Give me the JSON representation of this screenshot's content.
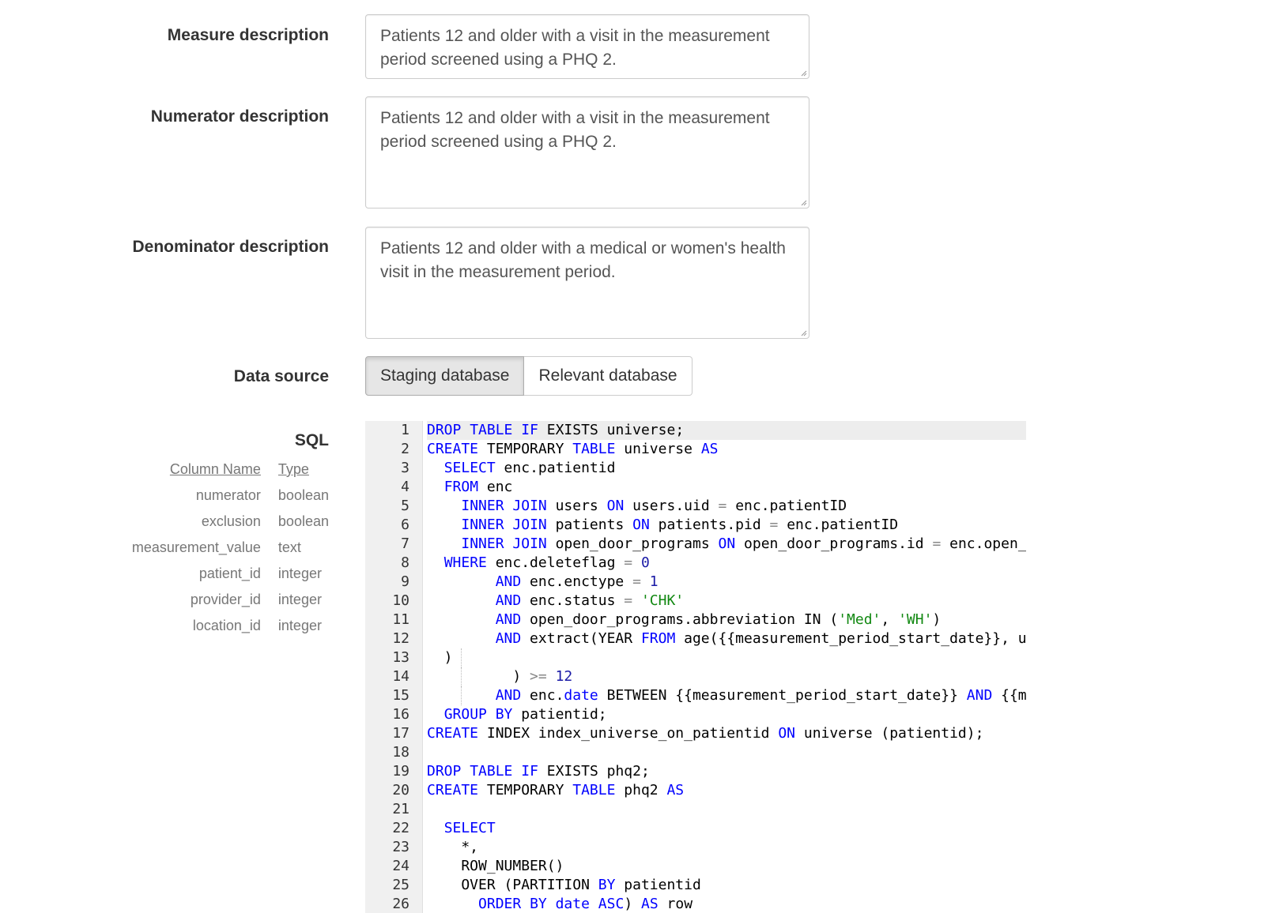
{
  "fields": {
    "measure_label": "Measure description",
    "measure_value": "Patients 12 and older with a visit in the measurement period screened using a PHQ 2.",
    "numerator_label": "Numerator description",
    "numerator_value": "Patients 12 and older with a visit in the measurement period screened using a PHQ 2.",
    "denominator_label": "Denominator description",
    "denominator_value": "Patients 12 and older with a medical or women's health visit in the measurement period."
  },
  "data_source": {
    "label": "Data source",
    "options": [
      "Staging database",
      "Relevant database"
    ],
    "selected": "Staging database"
  },
  "sql": {
    "label": "SQL",
    "schema_headers": [
      "Column Name",
      "Type"
    ],
    "schema_rows": [
      [
        "numerator",
        "boolean"
      ],
      [
        "exclusion",
        "boolean"
      ],
      [
        "measurement_value",
        "text"
      ],
      [
        "patient_id",
        "integer"
      ],
      [
        "provider_id",
        "integer"
      ],
      [
        "location_id",
        "integer"
      ]
    ],
    "code_lines": [
      "DROP TABLE IF EXISTS universe;",
      "CREATE TEMPORARY TABLE universe AS",
      "  SELECT enc.patientid",
      "  FROM enc",
      "    INNER JOIN users ON users.uid = enc.patientID",
      "    INNER JOIN patients ON patients.pid = enc.patientID",
      "    INNER JOIN open_door_programs ON open_door_programs.id = enc.open_",
      "  WHERE enc.deleteflag = 0",
      "        AND enc.enctype = 1",
      "        AND enc.status = 'CHK'",
      "        AND open_door_programs.abbreviation IN ('Med', 'WH')",
      "        AND extract(YEAR FROM age({{measurement_period_start_date}}, u",
      "  )",
      "          ) >= 12",
      "        AND enc.date BETWEEN {{measurement_period_start_date}} AND {{m",
      "  GROUP BY patientid;",
      "CREATE INDEX index_universe_on_patientid ON universe (patientid);",
      "",
      "DROP TABLE IF EXISTS phq2;",
      "CREATE TEMPORARY TABLE phq2 AS",
      "",
      "  SELECT",
      "    *,",
      "    ROW_NUMBER()",
      "    OVER (PARTITION BY patientid",
      "      ORDER BY date ASC) AS row"
    ]
  }
}
